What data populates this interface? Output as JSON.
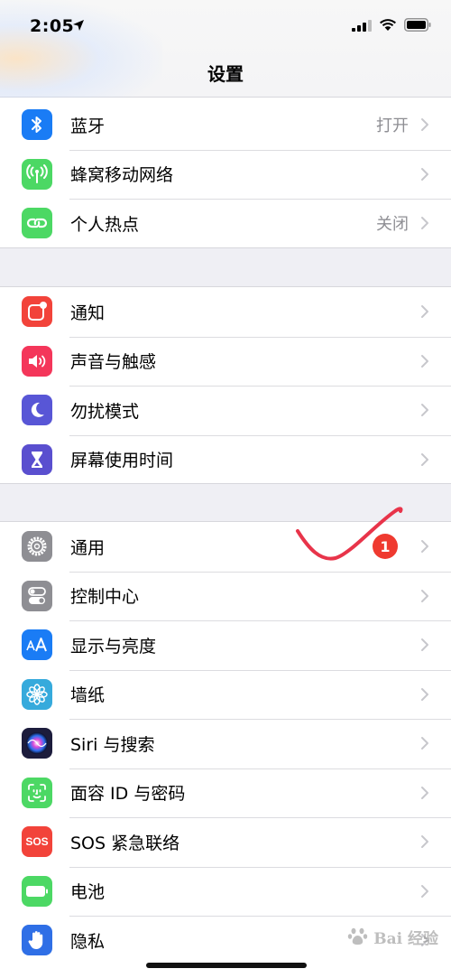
{
  "status_bar": {
    "time": "2:05"
  },
  "nav": {
    "title": "设置"
  },
  "groups": [
    {
      "items": [
        {
          "label": "蓝牙",
          "value": "打开",
          "icon": "bluetooth-icon",
          "color": "#1a7cf5"
        },
        {
          "label": "蜂窝移动网络",
          "value": "",
          "icon": "cellular-antenna-icon",
          "color": "#4cd864"
        },
        {
          "label": "个人热点",
          "value": "关闭",
          "icon": "personal-hotspot-icon",
          "color": "#4cd864"
        }
      ]
    },
    {
      "items": [
        {
          "label": "通知",
          "icon": "notifications-icon",
          "color": "#f2433a"
        },
        {
          "label": "声音与触感",
          "icon": "speaker-icon",
          "color": "#f4365a"
        },
        {
          "label": "勿扰模式",
          "icon": "moon-icon",
          "color": "#5856d6"
        },
        {
          "label": "屏幕使用时间",
          "icon": "hourglass-icon",
          "color": "#5a4fcf"
        }
      ]
    },
    {
      "items": [
        {
          "label": "通用",
          "badge": "1",
          "icon": "gear-icon",
          "color": "#8e8e93"
        },
        {
          "label": "控制中心",
          "icon": "toggles-icon",
          "color": "#8e8e93"
        },
        {
          "label": "显示与亮度",
          "icon": "text-size-icon",
          "color": "#1a7cf5"
        },
        {
          "label": "墙纸",
          "icon": "flower-icon",
          "color": "#36aadc"
        },
        {
          "label": "Siri 与搜索",
          "icon": "siri-icon",
          "color": "#1c1c3c"
        },
        {
          "label": "面容 ID 与密码",
          "icon": "face-id-icon",
          "color": "#4cd864"
        },
        {
          "label": "SOS 紧急联络",
          "icon": "sos-icon",
          "color": "#f2433a",
          "icon_text": "SOS"
        },
        {
          "label": "电池",
          "icon": "battery-icon",
          "color": "#4cd864"
        },
        {
          "label": "隐私",
          "icon": "hand-icon",
          "color": "#2f6fe6"
        }
      ]
    }
  ],
  "watermark": {
    "text": "Bai 经验"
  },
  "annotation": {
    "stroke_color": "#e8344a"
  }
}
